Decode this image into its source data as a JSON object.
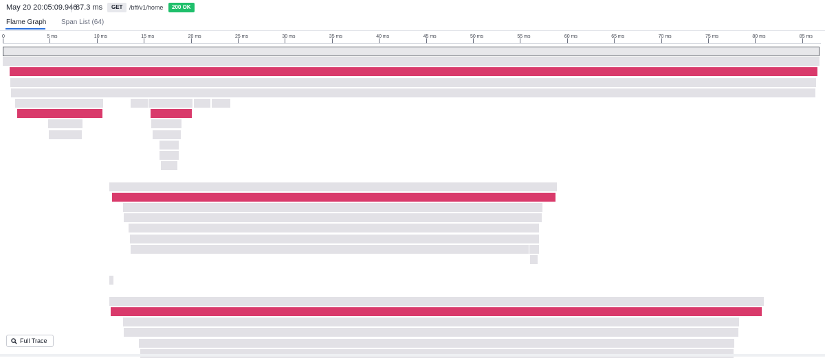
{
  "header": {
    "timestamp": "May 20 20:05:09.946",
    "duration": "87.3 ms",
    "method": "GET",
    "path": "/bff/v1/home",
    "status": "200 OK",
    "status_color": "#1fbf6b"
  },
  "tabs": [
    {
      "label": "Flame Graph",
      "active": true
    },
    {
      "label": "Span List (64)",
      "active": false
    }
  ],
  "timeline": {
    "unit": "ms",
    "ticks": [
      "0",
      "5 ms",
      "10 ms",
      "15 ms",
      "20 ms",
      "25 ms",
      "30 ms",
      "35 ms",
      "40 ms",
      "45 ms",
      "50 ms",
      "55 ms",
      "60 ms",
      "65 ms",
      "70 ms",
      "75 ms",
      "80 ms",
      "85 ms"
    ]
  },
  "colors": {
    "span_normal": "#e2e1e6",
    "span_highlight": "#d93a6b",
    "root_border": "#5a5d66",
    "accent": "#2a6fdb"
  },
  "flame": {
    "spans": [
      {
        "start_ms": 0.0,
        "end_ms": 87.3,
        "depth": 0,
        "kind": "root"
      },
      {
        "start_ms": 0.0,
        "end_ms": 87.2,
        "depth": 1,
        "kind": "normal"
      },
      {
        "start_ms": 0.7,
        "end_ms": 86.6,
        "depth": 2,
        "kind": "highlight"
      },
      {
        "start_ms": 0.8,
        "end_ms": 86.5,
        "depth": 3,
        "kind": "normal"
      },
      {
        "start_ms": 0.9,
        "end_ms": 86.4,
        "depth": 4,
        "kind": "normal"
      },
      {
        "start_ms": 1.3,
        "end_ms": 10.7,
        "depth": 5,
        "kind": "normal"
      },
      {
        "start_ms": 13.6,
        "end_ms": 15.4,
        "depth": 5,
        "kind": "normal"
      },
      {
        "start_ms": 15.5,
        "end_ms": 20.2,
        "depth": 5,
        "kind": "normal"
      },
      {
        "start_ms": 20.3,
        "end_ms": 22.1,
        "depth": 5,
        "kind": "normal"
      },
      {
        "start_ms": 22.2,
        "end_ms": 24.2,
        "depth": 5,
        "kind": "normal"
      },
      {
        "start_ms": 1.5,
        "end_ms": 10.6,
        "depth": 6,
        "kind": "highlight"
      },
      {
        "start_ms": 15.7,
        "end_ms": 20.1,
        "depth": 6,
        "kind": "highlight"
      },
      {
        "start_ms": 4.8,
        "end_ms": 8.5,
        "depth": 7,
        "kind": "normal"
      },
      {
        "start_ms": 15.8,
        "end_ms": 19.0,
        "depth": 7,
        "kind": "normal"
      },
      {
        "start_ms": 4.9,
        "end_ms": 8.4,
        "depth": 8,
        "kind": "normal"
      },
      {
        "start_ms": 15.9,
        "end_ms": 18.9,
        "depth": 8,
        "kind": "normal"
      },
      {
        "start_ms": 16.7,
        "end_ms": 18.7,
        "depth": 9,
        "kind": "normal"
      },
      {
        "start_ms": 16.7,
        "end_ms": 18.7,
        "depth": 10,
        "kind": "normal"
      },
      {
        "start_ms": 16.8,
        "end_ms": 18.6,
        "depth": 11,
        "kind": "normal"
      },
      {
        "start_ms": 11.3,
        "end_ms": 58.9,
        "depth": 13,
        "kind": "normal"
      },
      {
        "start_ms": 11.6,
        "end_ms": 58.8,
        "depth": 14,
        "kind": "highlight"
      },
      {
        "start_ms": 12.8,
        "end_ms": 57.4,
        "depth": 15,
        "kind": "normal"
      },
      {
        "start_ms": 12.9,
        "end_ms": 57.3,
        "depth": 16,
        "kind": "normal"
      },
      {
        "start_ms": 13.4,
        "end_ms": 57.0,
        "depth": 17,
        "kind": "normal"
      },
      {
        "start_ms": 13.5,
        "end_ms": 57.0,
        "depth": 18,
        "kind": "normal"
      },
      {
        "start_ms": 13.6,
        "end_ms": 55.9,
        "depth": 19,
        "kind": "normal"
      },
      {
        "start_ms": 56.0,
        "end_ms": 57.0,
        "depth": 19,
        "kind": "normal"
      },
      {
        "start_ms": 56.1,
        "end_ms": 56.9,
        "depth": 20,
        "kind": "normal"
      },
      {
        "start_ms": 11.3,
        "end_ms": 11.8,
        "depth": 22,
        "kind": "normal"
      },
      {
        "start_ms": 11.3,
        "end_ms": 80.9,
        "depth": 24,
        "kind": "normal"
      },
      {
        "start_ms": 11.5,
        "end_ms": 80.7,
        "depth": 25,
        "kind": "highlight"
      },
      {
        "start_ms": 12.8,
        "end_ms": 78.3,
        "depth": 26,
        "kind": "normal"
      },
      {
        "start_ms": 12.9,
        "end_ms": 78.2,
        "depth": 27,
        "kind": "normal"
      },
      {
        "start_ms": 14.5,
        "end_ms": 77.8,
        "depth": 28,
        "kind": "normal"
      },
      {
        "start_ms": 14.6,
        "end_ms": 77.7,
        "depth": 29,
        "kind": "normal"
      }
    ]
  },
  "footer": {
    "full_trace_label": "Full Trace",
    "full_trace_icon": "magnifier-icon"
  }
}
